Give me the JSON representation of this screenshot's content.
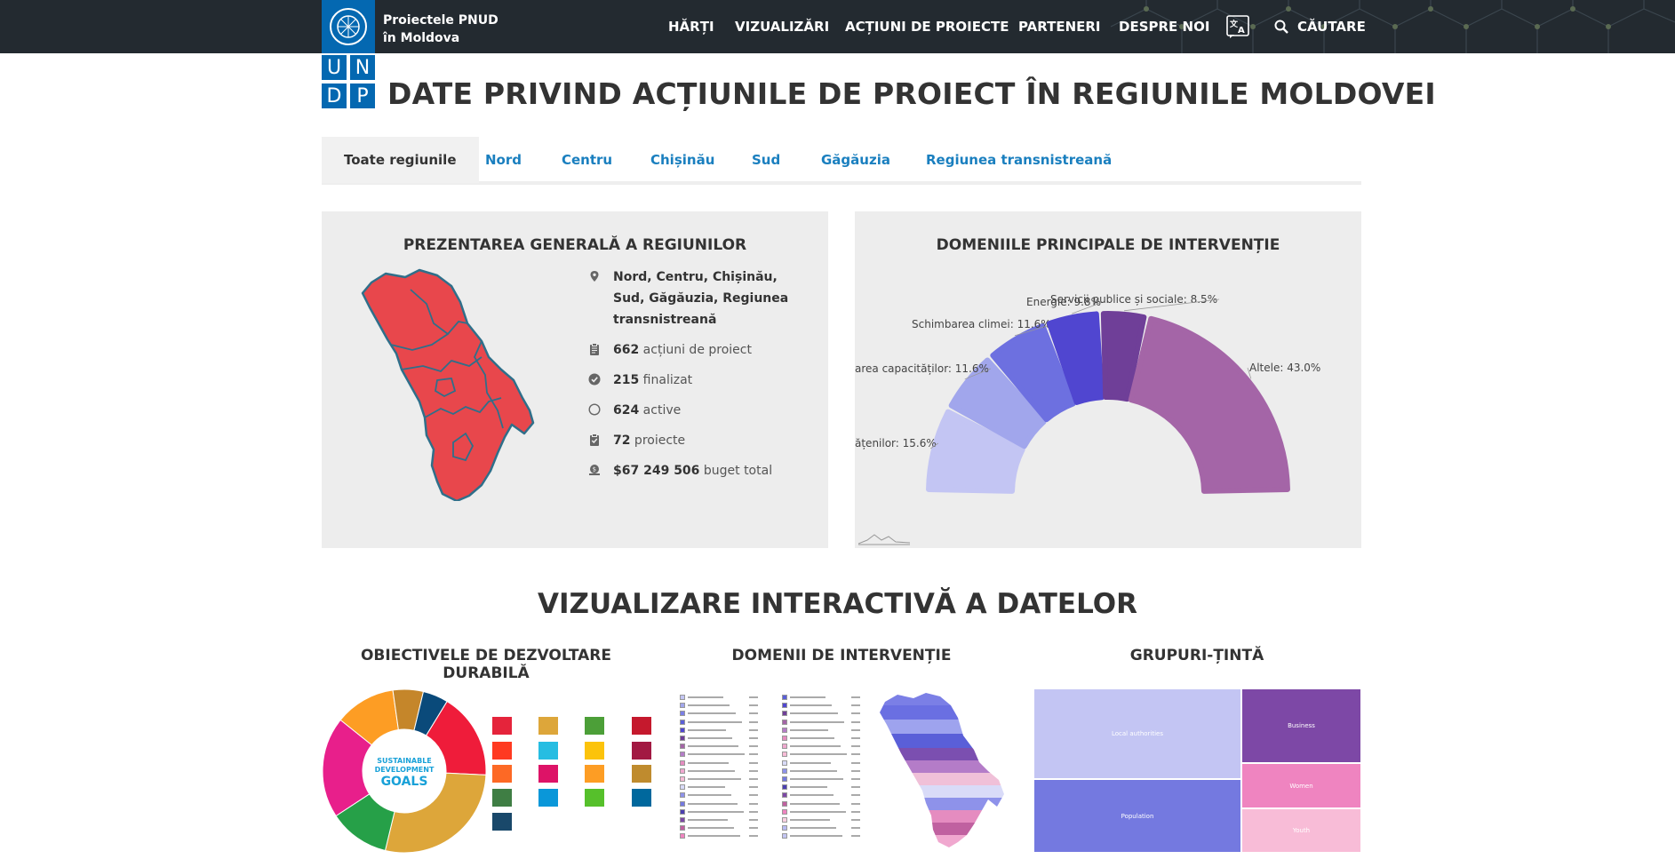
{
  "header": {
    "brand_line1": "Proiectele PNUD",
    "brand_line2": "în Moldova",
    "nav": [
      "HĂRȚI",
      "VIZUALIZĂRI",
      "ACȚIUNI DE PROIECTE",
      "PARTENERI",
      "DESPRE NOI"
    ],
    "search_label": "CĂUTARE"
  },
  "logo_letters": [
    "U",
    "N",
    "D",
    "P"
  ],
  "page_title": "DATE PRIVIND ACȚIUNILE DE PROIECT ÎN REGIUNILE MOLDOVEI",
  "tabs": [
    "Toate regiunile",
    "Nord",
    "Centru",
    "Chișinău",
    "Sud",
    "Găgăuzia",
    "Regiunea transnistreană"
  ],
  "overview": {
    "title": "PREZENTAREA GENERALĂ A REGIUNILOR",
    "regions": "Nord, Centru, Chișinău, Sud, Găgăuzia, Regiunea transnistreană",
    "actions_num": "662",
    "actions_label": " acțiuni de proiect",
    "completed_num": "215",
    "completed_label": " finalizat",
    "active_num": "624",
    "active_label": " active",
    "projects_num": "72",
    "projects_label": " proiecte",
    "budget_num": "$67 249 506",
    "budget_label": " buget total"
  },
  "domains": {
    "title": "DOMENIILE PRINCIPALE DE INTERVENȚIE"
  },
  "chart_data": {
    "type": "pie",
    "title": "DOMENIILE PRINCIPALE DE INTERVENȚIE",
    "visible_labels": [
      "ățenilor: 15.6%",
      "area capacităților: 11.6%",
      "Schimbarea climei: 11.6%",
      "Energie: 9.8%",
      "Servicii publice și sociale: 8.5%",
      "Altele: 43.0%"
    ],
    "values": [
      15.6,
      11.6,
      11.6,
      9.8,
      8.5,
      43.0
    ],
    "colors": [
      "#c3c5f3",
      "#a1a6ec",
      "#6d70e0",
      "#5046d0",
      "#6f3f98",
      "#a465a7"
    ]
  },
  "interactive": {
    "title": "VIZUALIZARE INTERACTIVĂ A DATELOR",
    "sdg_title": "OBIECTIVELE DE DEZVOLTARE DURABILĂ",
    "sdg_center1": "SUSTAINABLE",
    "sdg_center2": "DEVELOPMENT",
    "sdg_center3": "GOALS",
    "domains_title": "DOMENII DE INTERVENȚIE",
    "groups_title": "GRUPURI-ȚINTĂ",
    "treemap": [
      "Local authorities",
      "Business",
      "Population",
      "Women",
      "Youth"
    ]
  },
  "colors": {
    "header": "#232a30",
    "undp_blue": "#0468b1",
    "link": "#1a7fbf",
    "map_red": "#e8474c",
    "panel": "#ededed"
  }
}
